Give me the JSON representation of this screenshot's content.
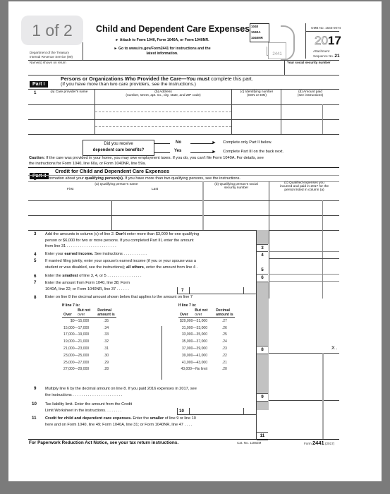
{
  "viewer": {
    "page_indicator": "1 of 2"
  },
  "header": {
    "title": "Child and Dependent Care Expenses",
    "attach_line": "► Attach to Form 1040, Form 1040A, or Form 1040NR.",
    "goto_line_1": "► Go to www.irs.gov/Form2441 for instructions and the",
    "goto_line_2": "latest information.",
    "dept_line_1": "Department of the Treasury",
    "dept_line_2": "Internal Revenue Service (99)",
    "form_icon_labels": [
      "1040",
      "1040A",
      "1040NR"
    ],
    "form_icon_number": "2441",
    "omb": "OMB No. 1545-0074",
    "year_outline": "20",
    "year_bold": "17",
    "attachment_label": "Attachment",
    "sequence_label": "Sequence No.",
    "sequence_no": "21",
    "name_label": "Name(s) shown on return",
    "ssn_label": "Your social security number"
  },
  "part1": {
    "badge": "Part I",
    "title_a": "Persons or Organizations Who Provided the Care—You ",
    "title_bold": "must",
    "title_b": " complete this part.",
    "subtitle": "(If you have more than two care providers, see the instructions.)",
    "line_no": "1",
    "col_a": "(a) Care provider's name",
    "col_b_1": "(b) Address",
    "col_b_2": "(number, street, apt. no., city, state, and ZIP code)",
    "col_c_1": "(c) Identifying number",
    "col_c_2": "(SSN or EIN)",
    "col_d_1": "(d) Amount paid",
    "col_d_2": "(see instructions)",
    "rows": [
      {
        "name": "",
        "address": "",
        "id": "",
        "amount": ""
      },
      {
        "name": "",
        "address": "",
        "id": "",
        "amount": ""
      }
    ],
    "question_1": "Did you receive",
    "question_2": "dependent care benefits?",
    "no_label": "No",
    "yes_label": "Yes",
    "no_result": "Complete only Part II below.",
    "yes_result": "Complete Part III on the back next.",
    "caution_label": "Caution:",
    "caution_text_1": " If the care was provided in your home, you may owe employment taxes. If you do, you can't file Form 1040A. For details, see",
    "caution_text_2": "the instructions for Form 1040, line 60a, or Form 1040NR, line 59a."
  },
  "part2": {
    "badge": "Part II",
    "title": "Credit for Child and Dependent Care Expenses",
    "line2_no": "2",
    "line2_a": "Information about your ",
    "line2_bold": "qualifying person(s).",
    "line2_b": " If you have more than two qualifying persons, see the instructions.",
    "col_a": "(a) Qualifying person's name",
    "col_first": "First",
    "col_last": "Last",
    "col_b_1": "(b) Qualifying person's social",
    "col_b_2": "security number",
    "col_c_1": "(c) Qualified expenses you",
    "col_c_2": "incurred and paid in 2017 for the",
    "col_c_3": "person listed in column (a)",
    "rows": [
      {
        "first": "",
        "last": "",
        "ssn": "",
        "expenses": ""
      },
      {
        "first": "",
        "last": "",
        "ssn": "",
        "expenses": ""
      }
    ],
    "lines": {
      "l3_no": "3",
      "l3_text_1a": "Add the amounts in column (c) of line 2. ",
      "l3_text_1b": "Don't",
      "l3_text_1c": " enter more than $3,000 for one qualifying",
      "l3_text_2": "person or $6,000 for two or more persons. If you completed Part III, enter the amount",
      "l3_text_3": "from line 31 . . . . . . . . . . . . . . . . . . . . . . .",
      "l4_no": "4",
      "l4_text_a": "Enter your ",
      "l4_text_b": "earned income.",
      "l4_text_c": " See instructions . . . . . . . . . . .",
      "l5_no": "5",
      "l5_text_1": "If married filing jointly, enter your spouse's earned income (if you or your spouse was a",
      "l5_text_2a": "student or was disabled, see the instructions); ",
      "l5_text_2b": "all others",
      "l5_text_2c": ", enter the amount from line 4 .",
      "l6_no": "6",
      "l6_text_a": "Enter the ",
      "l6_text_b": "smallest",
      "l6_text_c": " of line 3, 4, or 5 . . . . . . . . . . . . . . . .",
      "l7_no": "7",
      "l7_text_1": "Enter the amount from Form 1040, line 38; Form",
      "l7_text_2": "1040A, line 22; or Form 1040NR, line 37 . . . . . .",
      "l8_no": "8",
      "l8_text": "Enter on line 8 the decimal amount shown below that applies to the amount on line 7",
      "if_line7": "If line 7 is:",
      "hdr_but_not": "But not",
      "hdr_over": "Over",
      "hdr_over2": "over",
      "hdr_decimal": "Decimal",
      "hdr_amount_is": "amount is",
      "l8_value": "X .",
      "l9_no": "9",
      "l9_text_1": "Multiply line 6 by the decimal amount on line 8. If you paid 2016 expenses in 2017, see",
      "l9_text_2": "the instructions . . . . . . . . . . . . . . . . . . . . . . .",
      "l10_no": "10",
      "l10_text_1": "Tax liability limit. Enter the amount from the Credit",
      "l10_text_2": "Limit Worksheet in the instructions. . . . . . . .",
      "l11_no": "11",
      "l11_text_1a": "Credit for child and dependent care expenses.",
      "l11_text_1b": " Enter the ",
      "l11_text_1c": "smaller",
      "l11_text_1d": " of line 9 or line 10",
      "l11_text_2": "here and on Form 1040, line 49; Form 1040A, line 31; or Form 1040NR, line 47 . . . ."
    },
    "box_labels": [
      "3",
      "4",
      "5",
      "6",
      "7",
      "8",
      "9",
      "10",
      "11"
    ],
    "decimal_table_left": [
      {
        "range": "$0—15,000",
        "decimal": ".35"
      },
      {
        "range": "15,000—17,000",
        "decimal": ".34"
      },
      {
        "range": "17,000—19,000",
        "decimal": ".33"
      },
      {
        "range": "19,000—21,000",
        "decimal": ".32"
      },
      {
        "range": "21,000—23,000",
        "decimal": ".31"
      },
      {
        "range": "23,000—25,000",
        "decimal": ".30"
      },
      {
        "range": "25,000—27,000",
        "decimal": ".29"
      },
      {
        "range": "27,000—29,000",
        "decimal": ".28"
      }
    ],
    "decimal_table_right": [
      {
        "range": "$29,000—31,000",
        "decimal": ".27"
      },
      {
        "range": "31,000—33,000",
        "decimal": ".26"
      },
      {
        "range": "33,000—35,000",
        "decimal": ".25"
      },
      {
        "range": "35,000—37,000",
        "decimal": ".24"
      },
      {
        "range": "37,000—39,000",
        "decimal": ".23"
      },
      {
        "range": "39,000—41,000",
        "decimal": ".22"
      },
      {
        "range": "41,000—43,000",
        "decimal": ".21"
      },
      {
        "range": "43,000—No limit",
        "decimal": ".20"
      }
    ]
  },
  "footer": {
    "paperwork": "For Paperwork Reduction Act Notice, see your tax return instructions.",
    "cat_no": "Cat. No. 11862M",
    "form_label": "Form",
    "form_no": "2441",
    "form_year": "(2017)"
  }
}
